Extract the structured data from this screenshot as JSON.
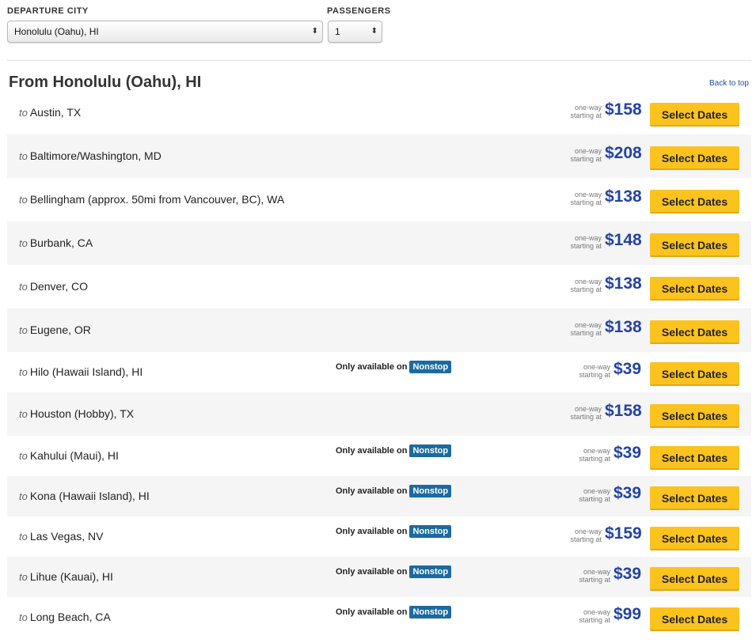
{
  "filters": {
    "departure_label": "DEPARTURE CITY",
    "departure_value": "Honolulu (Oahu), HI",
    "passengers_label": "PASSENGERS",
    "passengers_value": "1"
  },
  "heading": "From Honolulu (Oahu), HI",
  "back_to_top": "Back to top",
  "to_prefix": "to",
  "fare_label_line1": "one-way",
  "fare_label_line2": "starting at",
  "only_available_on": "Only available on",
  "nonstop_badge": "Nonstop",
  "select_dates": "Select Dates",
  "destinations": [
    {
      "city": "Austin, TX",
      "price": "$158",
      "nonstop_only": false
    },
    {
      "city": "Baltimore/Washington, MD",
      "price": "$208",
      "nonstop_only": false
    },
    {
      "city": "Bellingham (approx. 50mi from Vancouver, BC), WA",
      "price": "$138",
      "nonstop_only": false
    },
    {
      "city": "Burbank, CA",
      "price": "$148",
      "nonstop_only": false
    },
    {
      "city": "Denver, CO",
      "price": "$138",
      "nonstop_only": false
    },
    {
      "city": "Eugene, OR",
      "price": "$138",
      "nonstop_only": false
    },
    {
      "city": "Hilo (Hawaii Island), HI",
      "price": "$39",
      "nonstop_only": true
    },
    {
      "city": "Houston (Hobby), TX",
      "price": "$158",
      "nonstop_only": false
    },
    {
      "city": "Kahului (Maui), HI",
      "price": "$39",
      "nonstop_only": true
    },
    {
      "city": "Kona (Hawaii Island), HI",
      "price": "$39",
      "nonstop_only": true
    },
    {
      "city": "Las Vegas, NV",
      "price": "$159",
      "nonstop_only": true
    },
    {
      "city": "Lihue (Kauai), HI",
      "price": "$39",
      "nonstop_only": true
    },
    {
      "city": "Long Beach, CA",
      "price": "$99",
      "nonstop_only": true
    }
  ],
  "colors": {
    "price": "#2443a4",
    "button": "#fcc31e",
    "badge": "#1b6aa0",
    "row_shade": "#f5f5f5"
  }
}
